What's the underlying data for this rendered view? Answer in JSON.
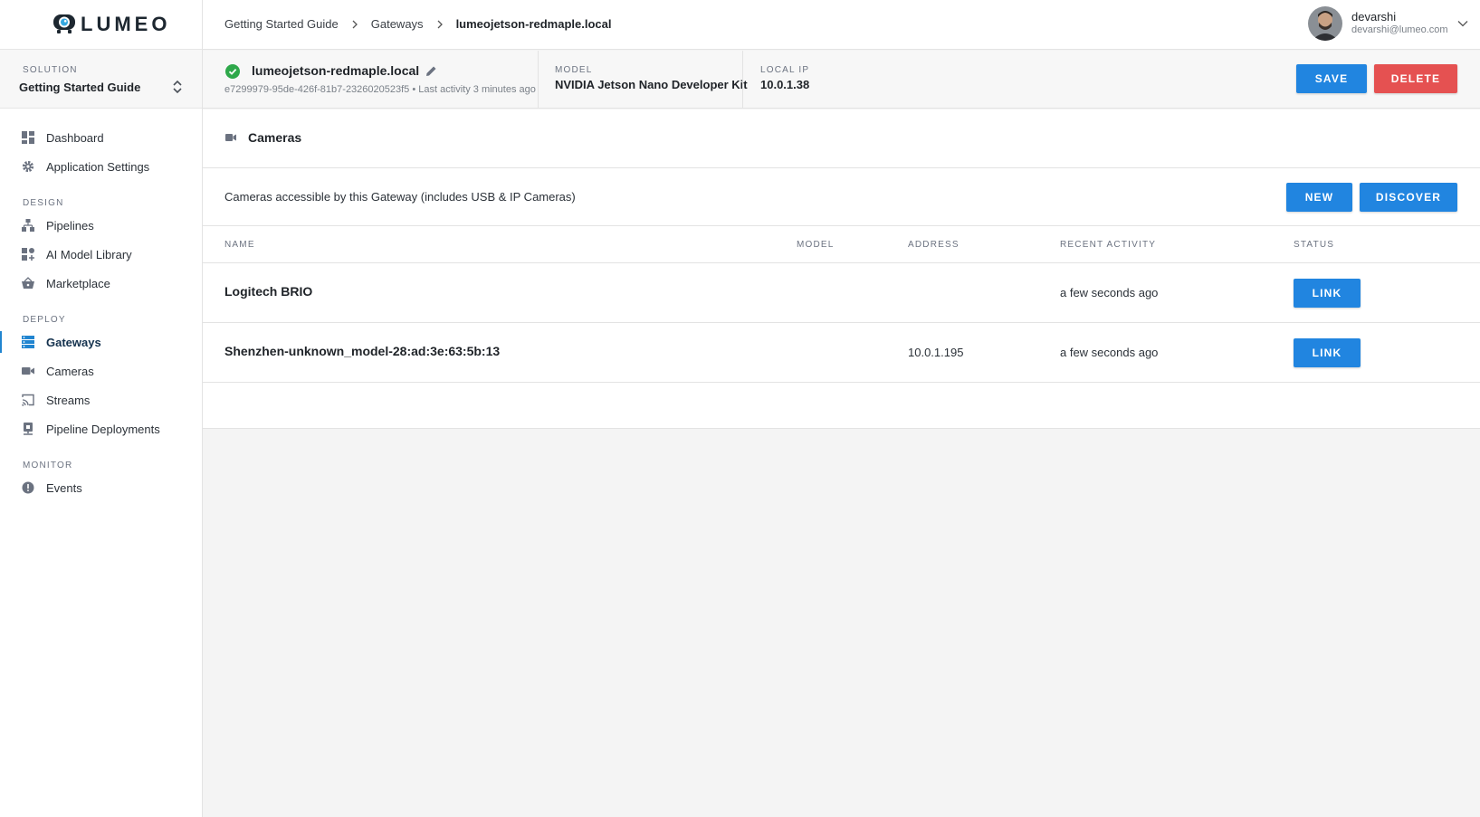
{
  "brand": {
    "name": "LUMEO"
  },
  "solution": {
    "label": "SOLUTION",
    "value": "Getting Started Guide"
  },
  "nav": {
    "top": [
      {
        "label": "Dashboard",
        "icon": "dashboard-icon"
      },
      {
        "label": "Application Settings",
        "icon": "gear-icon"
      }
    ],
    "design": {
      "label": "DESIGN",
      "items": [
        {
          "label": "Pipelines",
          "icon": "pipelines-icon"
        },
        {
          "label": "AI Model Library",
          "icon": "model-library-icon"
        },
        {
          "label": "Marketplace",
          "icon": "basket-icon"
        }
      ]
    },
    "deploy": {
      "label": "DEPLOY",
      "items": [
        {
          "label": "Gateways",
          "icon": "gateways-icon",
          "active": true
        },
        {
          "label": "Cameras",
          "icon": "camera-icon"
        },
        {
          "label": "Streams",
          "icon": "cast-icon"
        },
        {
          "label": "Pipeline Deployments",
          "icon": "deployments-icon"
        }
      ]
    },
    "monitor": {
      "label": "MONITOR",
      "items": [
        {
          "label": "Events",
          "icon": "alert-icon"
        }
      ]
    }
  },
  "breadcrumb": [
    "Getting Started Guide",
    "Gateways",
    "lumeojetson-redmaple.local"
  ],
  "user": {
    "name": "devarshi",
    "email": "devarshi@lumeo.com"
  },
  "gateway": {
    "name": "lumeojetson-redmaple.local",
    "subtitle": "e7299979-95de-426f-81b7-2326020523f5 • Last activity 3 minutes ago",
    "model_label": "MODEL",
    "model_value": "NVIDIA Jetson Nano Developer Kit",
    "ip_label": "LOCAL IP",
    "ip_value": "10.0.1.38",
    "status_color": "#2ea84a"
  },
  "actions": {
    "save": "SAVE",
    "delete": "DELETE"
  },
  "cameras": {
    "title": "Cameras",
    "description": "Cameras accessible by this Gateway (includes USB & IP Cameras)",
    "new_label": "NEW",
    "discover_label": "DISCOVER",
    "columns": [
      "NAME",
      "MODEL",
      "ADDRESS",
      "RECENT ACTIVITY",
      "STATUS"
    ],
    "rows": [
      {
        "name": "Logitech BRIO",
        "model": "",
        "address": "",
        "activity": "a few seconds ago",
        "action": "LINK"
      },
      {
        "name": "Shenzhen-unknown_model-28:ad:3e:63:5b:13",
        "model": "",
        "address": "10.0.1.195",
        "activity": "a few seconds ago",
        "action": "LINK"
      }
    ]
  },
  "colors": {
    "accent": "#2185e0",
    "danger": "#e55151",
    "active_nav": "#2185d0"
  }
}
